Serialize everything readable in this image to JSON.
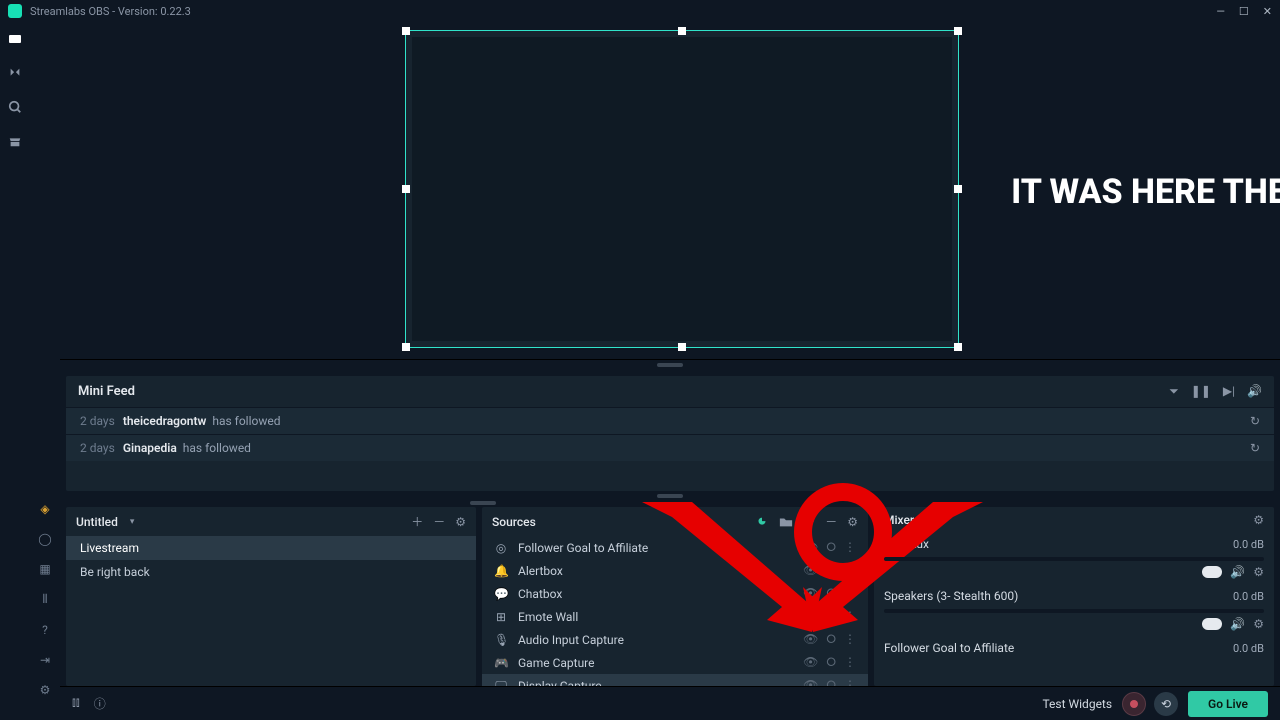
{
  "titlebar": {
    "title": "Streamlabs OBS - Version: 0.22.3"
  },
  "overlay": {
    "text": "IT WAS HERE THE WHOLE TIME -__-"
  },
  "minifeed": {
    "title": "Mini Feed",
    "rows": [
      {
        "time": "2 days",
        "user": "theicedragontw",
        "action": "has followed"
      },
      {
        "time": "2 days",
        "user": "Ginapedia",
        "action": "has followed"
      }
    ]
  },
  "scenes": {
    "title": "Untitled",
    "items": [
      {
        "label": "Livestream",
        "active": true
      },
      {
        "label": "Be right back",
        "active": false
      }
    ]
  },
  "sources": {
    "title": "Sources",
    "items": [
      {
        "icon": "target",
        "label": "Follower Goal to Affiliate"
      },
      {
        "icon": "bell",
        "label": "Alertbox"
      },
      {
        "icon": "chat",
        "label": "Chatbox"
      },
      {
        "icon": "grid",
        "label": "Emote Wall"
      },
      {
        "icon": "mic",
        "label": "Audio Input Capture"
      },
      {
        "icon": "gamepad",
        "label": "Game Capture"
      },
      {
        "icon": "monitor",
        "label": "Display Capture",
        "active": true
      }
    ]
  },
  "mixer": {
    "title": "Mixer",
    "channels": [
      {
        "name": "Mic/Aux",
        "db": "0.0 dB",
        "ctrls": true
      },
      {
        "name": "Speakers (3- Stealth 600)",
        "db": "0.0 dB",
        "ctrls": true
      },
      {
        "name": "Follower Goal to Affiliate",
        "db": "0.0 dB",
        "ctrls": false
      }
    ]
  },
  "bottombar": {
    "testWidgets": "Test Widgets",
    "goLive": "Go Live"
  }
}
